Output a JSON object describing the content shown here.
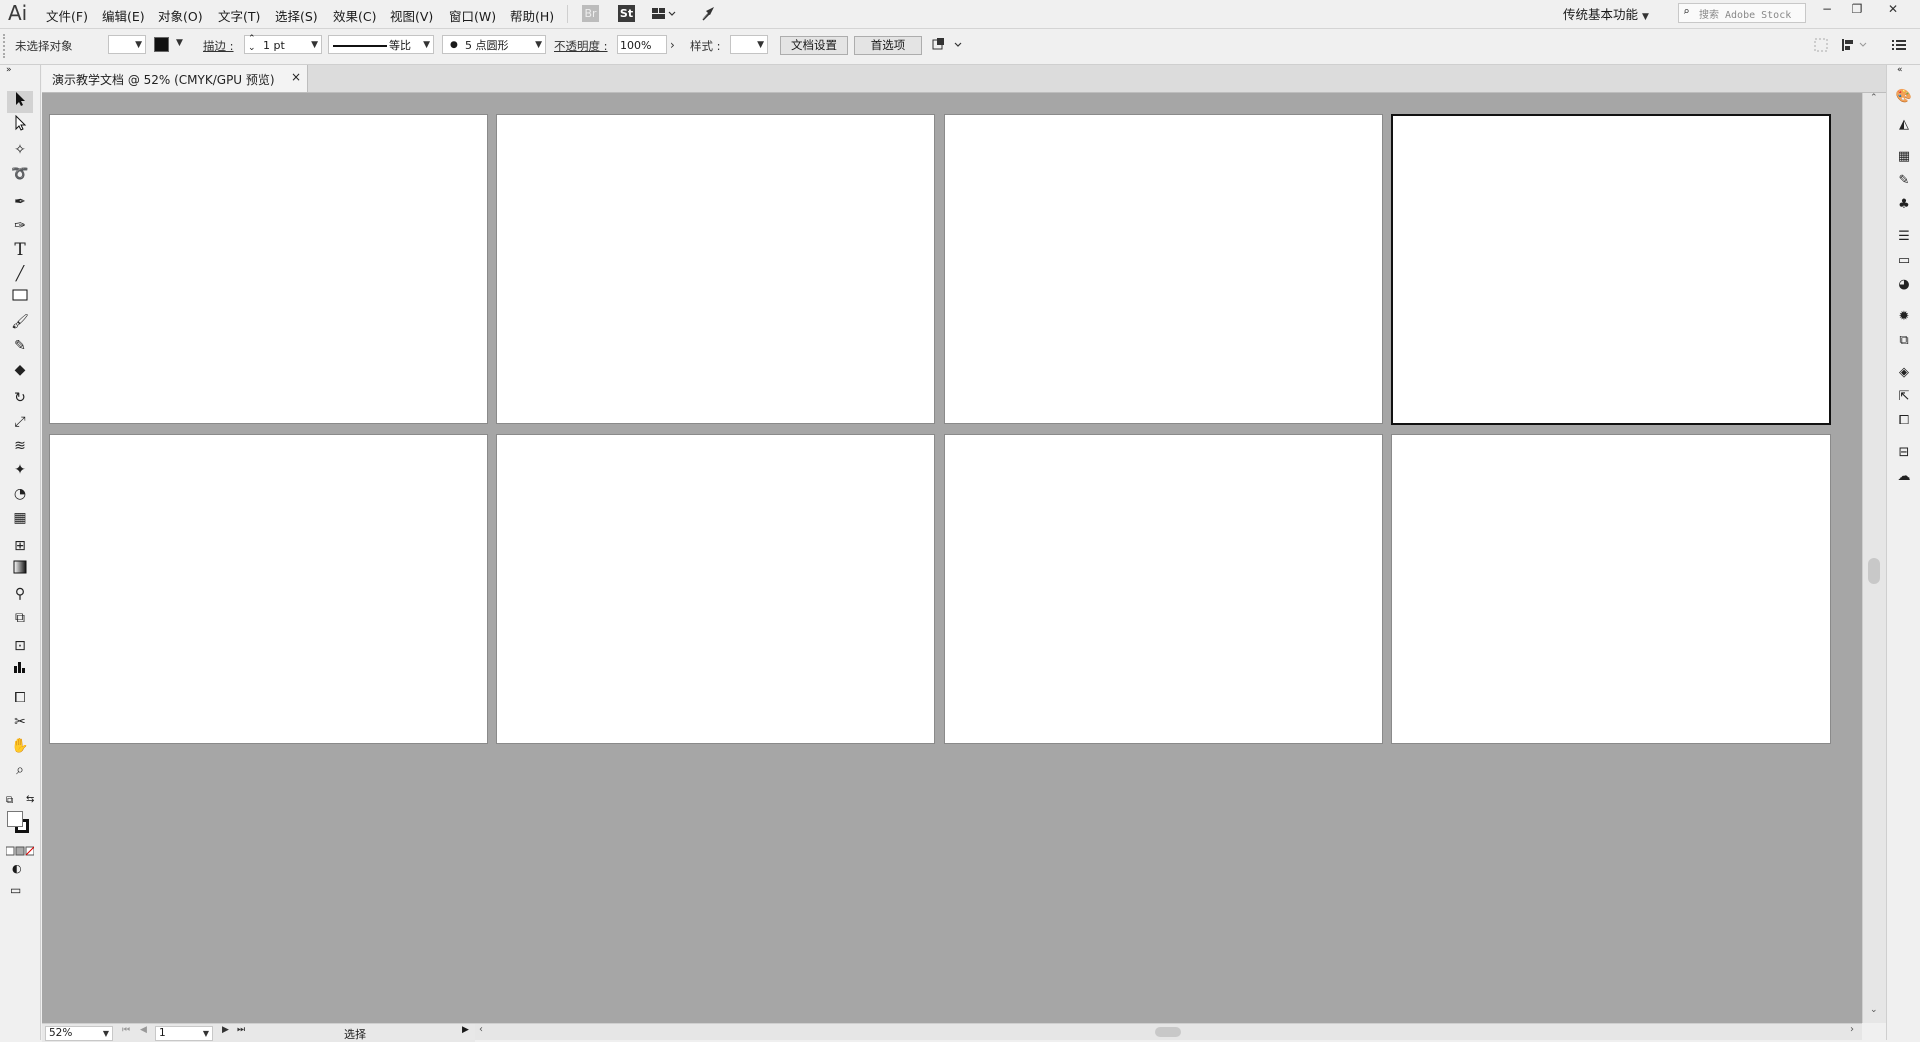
{
  "app": {
    "logo": "Ai"
  },
  "menu": {
    "items": [
      "文件(F)",
      "编辑(E)",
      "对象(O)",
      "文字(T)",
      "选择(S)",
      "效果(C)",
      "视图(V)",
      "窗口(W)",
      "帮助(H)"
    ],
    "bridge_label": "Br",
    "stock_label": "St"
  },
  "workspace": {
    "label": "传统基本功能"
  },
  "search": {
    "placeholder": "搜索 Adobe Stock"
  },
  "control_bar": {
    "selection_status": "未选择对象",
    "stroke_label": "描边 :",
    "stroke_weight": "1 pt",
    "stroke_profile": "等比",
    "brush": "5 点圆形",
    "opacity_label": "不透明度 :",
    "opacity_value": "100%",
    "style_label": "样式 :",
    "doc_setup_button": "文档设置",
    "preferences_button": "首选项"
  },
  "document_tab": {
    "title": "演示教学文档 @ 52% (CMYK/GPU 预览)",
    "close": "×"
  },
  "artboards": {
    "count": 8,
    "active_index": 3
  },
  "status_bar": {
    "zoom": "52%",
    "artboard_number": "1",
    "mode": "选择"
  },
  "icons": {
    "toolbar": [
      "selection-tool",
      "direct-selection-tool",
      "magic-wand-tool",
      "lasso-tool",
      "pen-tool",
      "curvature-tool",
      "type-tool",
      "line-tool",
      "rectangle-tool",
      "paintbrush-tool",
      "shaper-tool",
      "eraser-tool",
      "rotate-tool",
      "scale-tool",
      "width-tool",
      "puppet-warp-tool",
      "shape-builder-tool",
      "perspective-grid-tool",
      "mesh-tool",
      "gradient-tool",
      "eyedropper-tool",
      "blend-tool",
      "symbol-sprayer-tool",
      "column-graph-tool",
      "artboard-tool",
      "slice-tool",
      "hand-tool",
      "zoom-tool"
    ],
    "right_panel": [
      "color-panel",
      "color-guide-panel",
      "swatches-panel",
      "brushes-panel",
      "symbols-panel",
      "stroke-panel",
      "gradient-panel",
      "transparency-panel",
      "appearance-panel",
      "graphic-styles-panel",
      "layers-panel",
      "asset-export-panel",
      "artboards-panel",
      "libraries-panel",
      "creative-cloud-panel"
    ]
  }
}
